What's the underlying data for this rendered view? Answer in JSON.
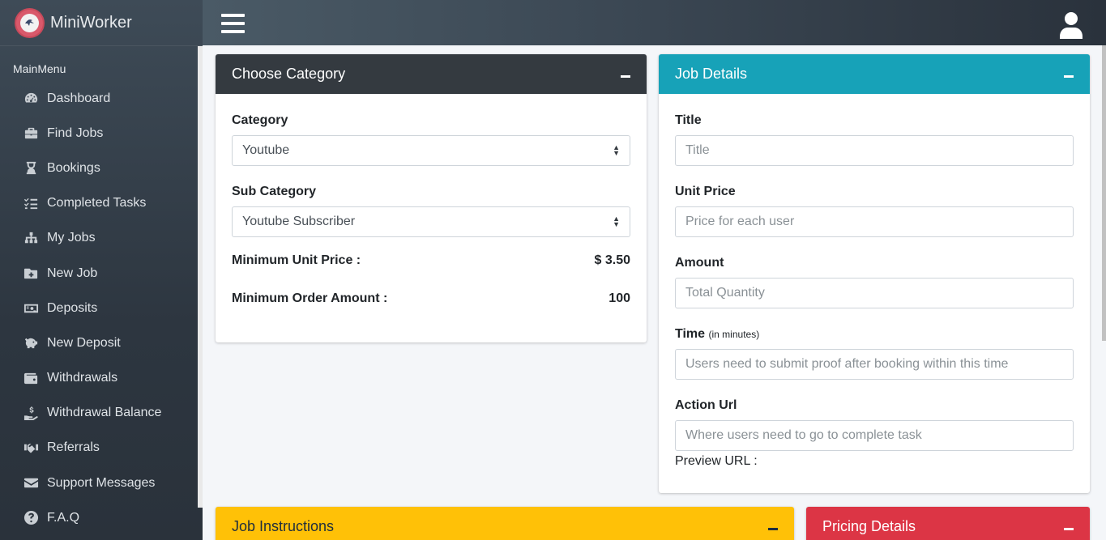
{
  "brand": {
    "name": "MiniWorker"
  },
  "sidebar": {
    "header": "MainMenu",
    "items": [
      {
        "label": "Dashboard",
        "icon": "dashboard-icon"
      },
      {
        "label": "Find Jobs",
        "icon": "briefcase-icon"
      },
      {
        "label": "Bookings",
        "icon": "hourglass-icon"
      },
      {
        "label": "Completed Tasks",
        "icon": "tasks-icon"
      },
      {
        "label": "My Jobs",
        "icon": "sitemap-icon"
      },
      {
        "label": "New Job",
        "icon": "folder-plus-icon"
      },
      {
        "label": "Deposits",
        "icon": "money-bill-icon"
      },
      {
        "label": "New Deposit",
        "icon": "piggy-bank-icon"
      },
      {
        "label": "Withdrawals",
        "icon": "wallet-icon"
      },
      {
        "label": "Withdrawal Balance",
        "icon": "hand-dollar-icon"
      },
      {
        "label": "Referrals",
        "icon": "handshake-icon"
      },
      {
        "label": "Support Messages",
        "icon": "envelope-icon"
      },
      {
        "label": "F.A.Q",
        "icon": "question-circle-icon"
      }
    ]
  },
  "category_card": {
    "title": "Choose Category",
    "category_label": "Category",
    "category_value": "Youtube",
    "subcategory_label": "Sub Category",
    "subcategory_value": "Youtube Subscriber",
    "min_price_label": "Minimum Unit Price :",
    "min_price_value": "$ 3.50",
    "min_amount_label": "Minimum Order Amount :",
    "min_amount_value": "100"
  },
  "job_details": {
    "title": "Job Details",
    "title_label": "Title",
    "title_placeholder": "Title",
    "price_label": "Unit Price",
    "price_placeholder": "Price for each user",
    "amount_label": "Amount",
    "amount_placeholder": "Total Quantity",
    "time_label": "Time",
    "time_hint": "(in minutes)",
    "time_placeholder": "Users need to submit proof after booking within this time",
    "url_label": "Action Url",
    "url_placeholder": "Where users need to go to complete task",
    "preview_label": "Preview URL :"
  },
  "instructions_card": {
    "title": "Job Instructions"
  },
  "pricing_card": {
    "title": "Pricing Details"
  },
  "colors": {
    "dark": "#343a40",
    "info": "#17a2b8",
    "warning": "#ffc107",
    "danger": "#dc3545"
  }
}
